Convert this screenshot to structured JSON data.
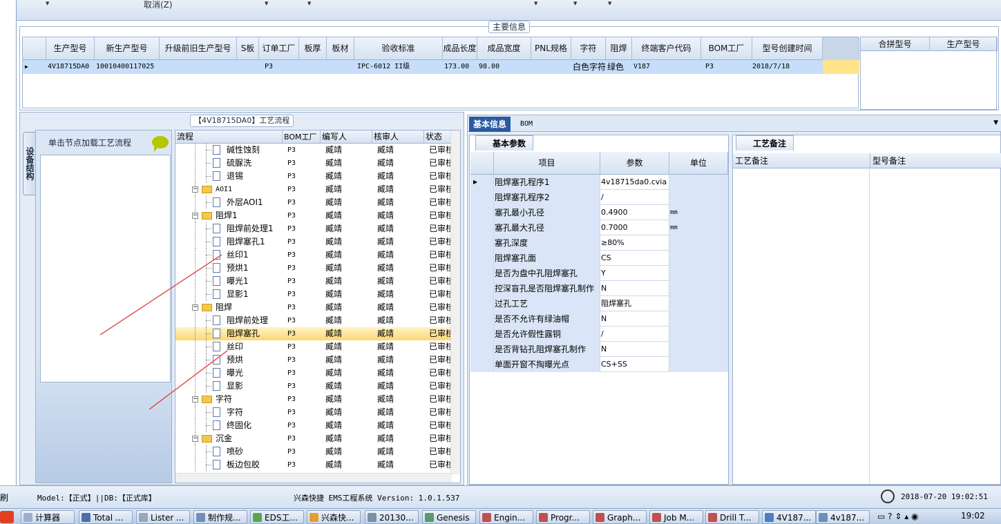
{
  "toolbar": {
    "cancel": "取消(Z)"
  },
  "main_group": {
    "title": "主要信息"
  },
  "main_grid": {
    "headers": [
      "生产型号",
      "新生产型号",
      "升级前旧生产型号",
      "S板",
      "订单工厂",
      "板厚",
      "板材",
      "验收标准",
      "成品长度",
      "成品宽度",
      "PNL规格",
      "字符",
      "阻焊",
      "终端客户代码",
      "BOM工厂",
      "型号创建时间"
    ],
    "row": [
      "4V18715DA0",
      "10010400117025",
      "",
      "",
      "P3",
      "",
      "",
      "IPC-6012 II级",
      "173.00",
      "98.00",
      "",
      "白色字符",
      "绿色",
      "V187",
      "P3",
      "2018/7/18"
    ]
  },
  "merge_grid": {
    "headers": [
      "合拼型号",
      "生产型号"
    ]
  },
  "flow_group": {
    "title": "【4V18715DA0】工艺流程"
  },
  "device": {
    "tab": "设备结构",
    "hint": "单击节点加载工艺流程"
  },
  "tree": {
    "headers": [
      "流程",
      "BOM工厂",
      "编写人",
      "核审人",
      "状态"
    ],
    "rows": [
      {
        "name": "碱性蚀刻",
        "bom": "P3",
        "writer": "臧靖",
        "checker": "臧靖",
        "status": "已审核"
      },
      {
        "name": "硫脲洗",
        "bom": "P3",
        "writer": "臧靖",
        "checker": "臧靖",
        "status": "已审核"
      },
      {
        "name": "退锡",
        "bom": "P3",
        "writer": "臧靖",
        "checker": "臧靖",
        "status": "已审核"
      },
      {
        "name": "AOI1",
        "bom": "P3",
        "writer": "臧靖",
        "checker": "臧靖",
        "status": "已审核"
      },
      {
        "name": "外层AOI1",
        "bom": "P3",
        "writer": "臧靖",
        "checker": "臧靖",
        "status": "已审核"
      },
      {
        "name": "阻焊1",
        "bom": "P3",
        "writer": "臧靖",
        "checker": "臧靖",
        "status": "已审核"
      },
      {
        "name": "阻焊前处理1",
        "bom": "P3",
        "writer": "臧靖",
        "checker": "臧靖",
        "status": "已审核"
      },
      {
        "name": "阻焊塞孔1",
        "bom": "P3",
        "writer": "臧靖",
        "checker": "臧靖",
        "status": "已审核"
      },
      {
        "name": "丝印1",
        "bom": "P3",
        "writer": "臧靖",
        "checker": "臧靖",
        "status": "已审核"
      },
      {
        "name": "预烘1",
        "bom": "P3",
        "writer": "臧靖",
        "checker": "臧靖",
        "status": "已审核"
      },
      {
        "name": "曝光1",
        "bom": "P3",
        "writer": "臧靖",
        "checker": "臧靖",
        "status": "已审核"
      },
      {
        "name": "显影1",
        "bom": "P3",
        "writer": "臧靖",
        "checker": "臧靖",
        "status": "已审核"
      },
      {
        "name": "阻焊",
        "bom": "P3",
        "writer": "臧靖",
        "checker": "臧靖",
        "status": "已审核"
      },
      {
        "name": "阻焊前处理",
        "bom": "P3",
        "writer": "臧靖",
        "checker": "臧靖",
        "status": "已审核"
      },
      {
        "name": "阻焊塞孔",
        "bom": "P3",
        "writer": "臧靖",
        "checker": "臧靖",
        "status": "已审核"
      },
      {
        "name": "丝印",
        "bom": "P3",
        "writer": "臧靖",
        "checker": "臧靖",
        "status": "已审核"
      },
      {
        "name": "预烘",
        "bom": "P3",
        "writer": "臧靖",
        "checker": "臧靖",
        "status": "已审核"
      },
      {
        "name": "曝光",
        "bom": "P3",
        "writer": "臧靖",
        "checker": "臧靖",
        "status": "已审核"
      },
      {
        "name": "显影",
        "bom": "P3",
        "writer": "臧靖",
        "checker": "臧靖",
        "status": "已审核"
      },
      {
        "name": "字符",
        "bom": "P3",
        "writer": "臧靖",
        "checker": "臧靖",
        "status": "已审核"
      },
      {
        "name": "字符",
        "bom": "P3",
        "writer": "臧靖",
        "checker": "臧靖",
        "status": "已审核"
      },
      {
        "name": "终固化",
        "bom": "P3",
        "writer": "臧靖",
        "checker": "臧靖",
        "status": "已审核"
      },
      {
        "name": "沉金",
        "bom": "P3",
        "writer": "臧靖",
        "checker": "臧靖",
        "status": "已审核"
      },
      {
        "name": "喷砂",
        "bom": "P3",
        "writer": "臧靖",
        "checker": "臧靖",
        "status": "已审核"
      },
      {
        "name": "板边包胶",
        "bom": "P3",
        "writer": "臧靖",
        "checker": "臧靖",
        "status": "已审核"
      }
    ]
  },
  "right_tabs": [
    "基本信息",
    "BOM"
  ],
  "basic": {
    "tab": "基本参数",
    "headers": [
      "项目",
      "参数",
      "单位"
    ],
    "rows": [
      {
        "item": "阻焊塞孔程序1",
        "value": "4v18715da0.cvia",
        "unit": ""
      },
      {
        "item": "阻焊塞孔程序2",
        "value": "/",
        "unit": ""
      },
      {
        "item": "塞孔最小孔径",
        "value": "0.4900",
        "unit": "mm"
      },
      {
        "item": "塞孔最大孔径",
        "value": "0.7000",
        "unit": "mm"
      },
      {
        "item": "塞孔深度",
        "value": "≥80%",
        "unit": ""
      },
      {
        "item": "阻焊塞孔面",
        "value": "CS",
        "unit": ""
      },
      {
        "item": "是否为盘中孔阻焊塞孔",
        "value": "Y",
        "unit": ""
      },
      {
        "item": "控深盲孔是否阻焊塞孔制作",
        "value": "N",
        "unit": ""
      },
      {
        "item": "过孔工艺",
        "value": "阻焊塞孔",
        "unit": ""
      },
      {
        "item": "是否不允许有绿油帽",
        "value": "N",
        "unit": ""
      },
      {
        "item": "是否允许假性露铜",
        "value": "/",
        "unit": ""
      },
      {
        "item": "是否背钻孔阻焊塞孔制作",
        "value": "N",
        "unit": ""
      },
      {
        "item": "单面开窗不掏曝光点",
        "value": "CS+SS",
        "unit": ""
      }
    ]
  },
  "notes": {
    "tab": "工艺备注",
    "headers": [
      "工艺备注",
      "型号备注"
    ]
  },
  "status": {
    "model": "Model:【正式】||DB:【正式库】",
    "app": "兴森快捷 EMS工程系统 Version: 1.0.1.537",
    "time": "2018-07-20 19:02:51",
    "edge": "刷"
  },
  "taskbar": {
    "items": [
      "计算器",
      "Total ...",
      "Lister ...",
      "制作规...",
      "EDS工...",
      "兴森快...",
      "20130...",
      "Genesis",
      "Engin...",
      "Progr...",
      "Graph...",
      "Job M...",
      "Drill T...",
      "4V187...",
      "4v187..."
    ],
    "clock": "19:02"
  },
  "colors": {
    "selection": "#fcd873",
    "row_select": "#c6def9",
    "accent": "#2a5aa0"
  }
}
